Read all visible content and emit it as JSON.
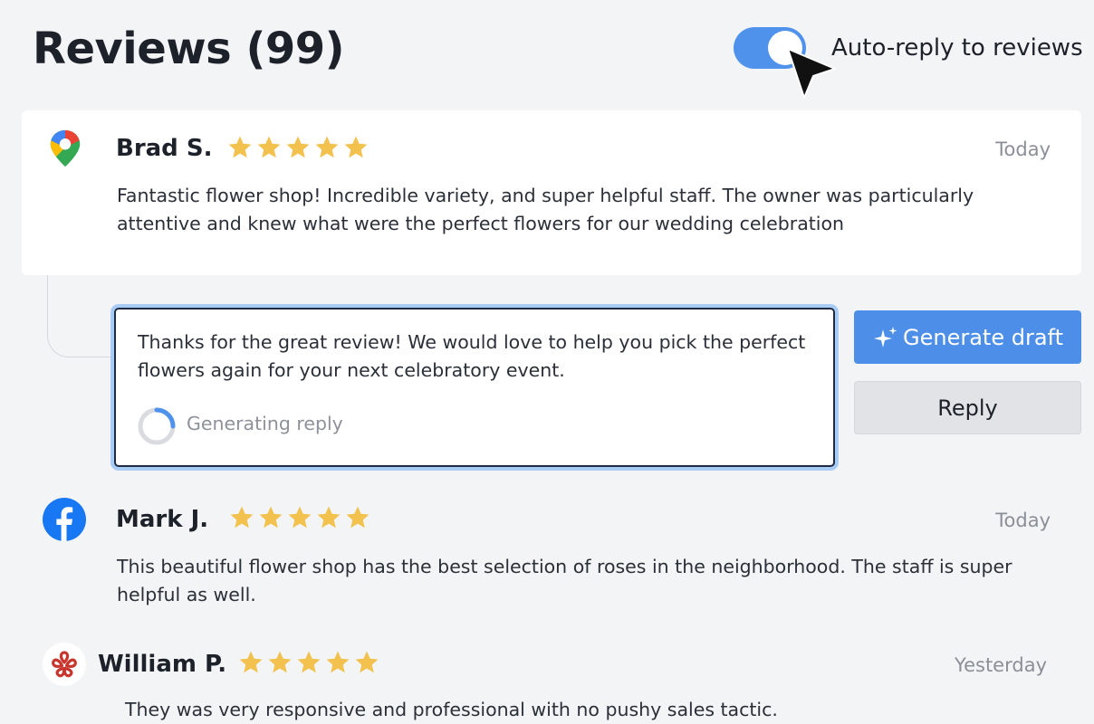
{
  "header": {
    "title": "Reviews (99)",
    "auto_reply_label": "Auto-reply to reviews",
    "auto_reply_enabled": true
  },
  "reviews": [
    {
      "source_icon": "google-maps-icon",
      "name": "Brad S.",
      "rating": 5,
      "date": "Today",
      "text_lines": [
        "Fantastic flower shop! Incredible variety, and super helpful staff.  The owner was particularly",
        "attentive and knew what were the  perfect flowers for our wedding celebration"
      ]
    },
    {
      "source_icon": "facebook-icon",
      "name": "Mark J.",
      "rating": 5,
      "date": "Today",
      "text_lines": [
        "This beautiful flower shop has the best selection of roses in the neighborhood. The staff is super",
        "helpful as well."
      ]
    },
    {
      "source_icon": "yelp-icon",
      "name": "William P.",
      "rating": 5,
      "date": "Yesterday",
      "text_lines": [
        "They was very responsive and professional with no pushy sales tactic."
      ]
    }
  ],
  "reply": {
    "draft_lines": [
      "Thanks for the great review! We would love to help you pick the perfect",
      "flowers again for your next celebratory event."
    ],
    "status": "Generating reply"
  },
  "actions": {
    "generate_label": "Generate draft",
    "reply_label": "Reply"
  },
  "colors": {
    "accent": "#4c8ee8",
    "star": "#f2c14e",
    "focus_ring": "#a8ccf3"
  }
}
